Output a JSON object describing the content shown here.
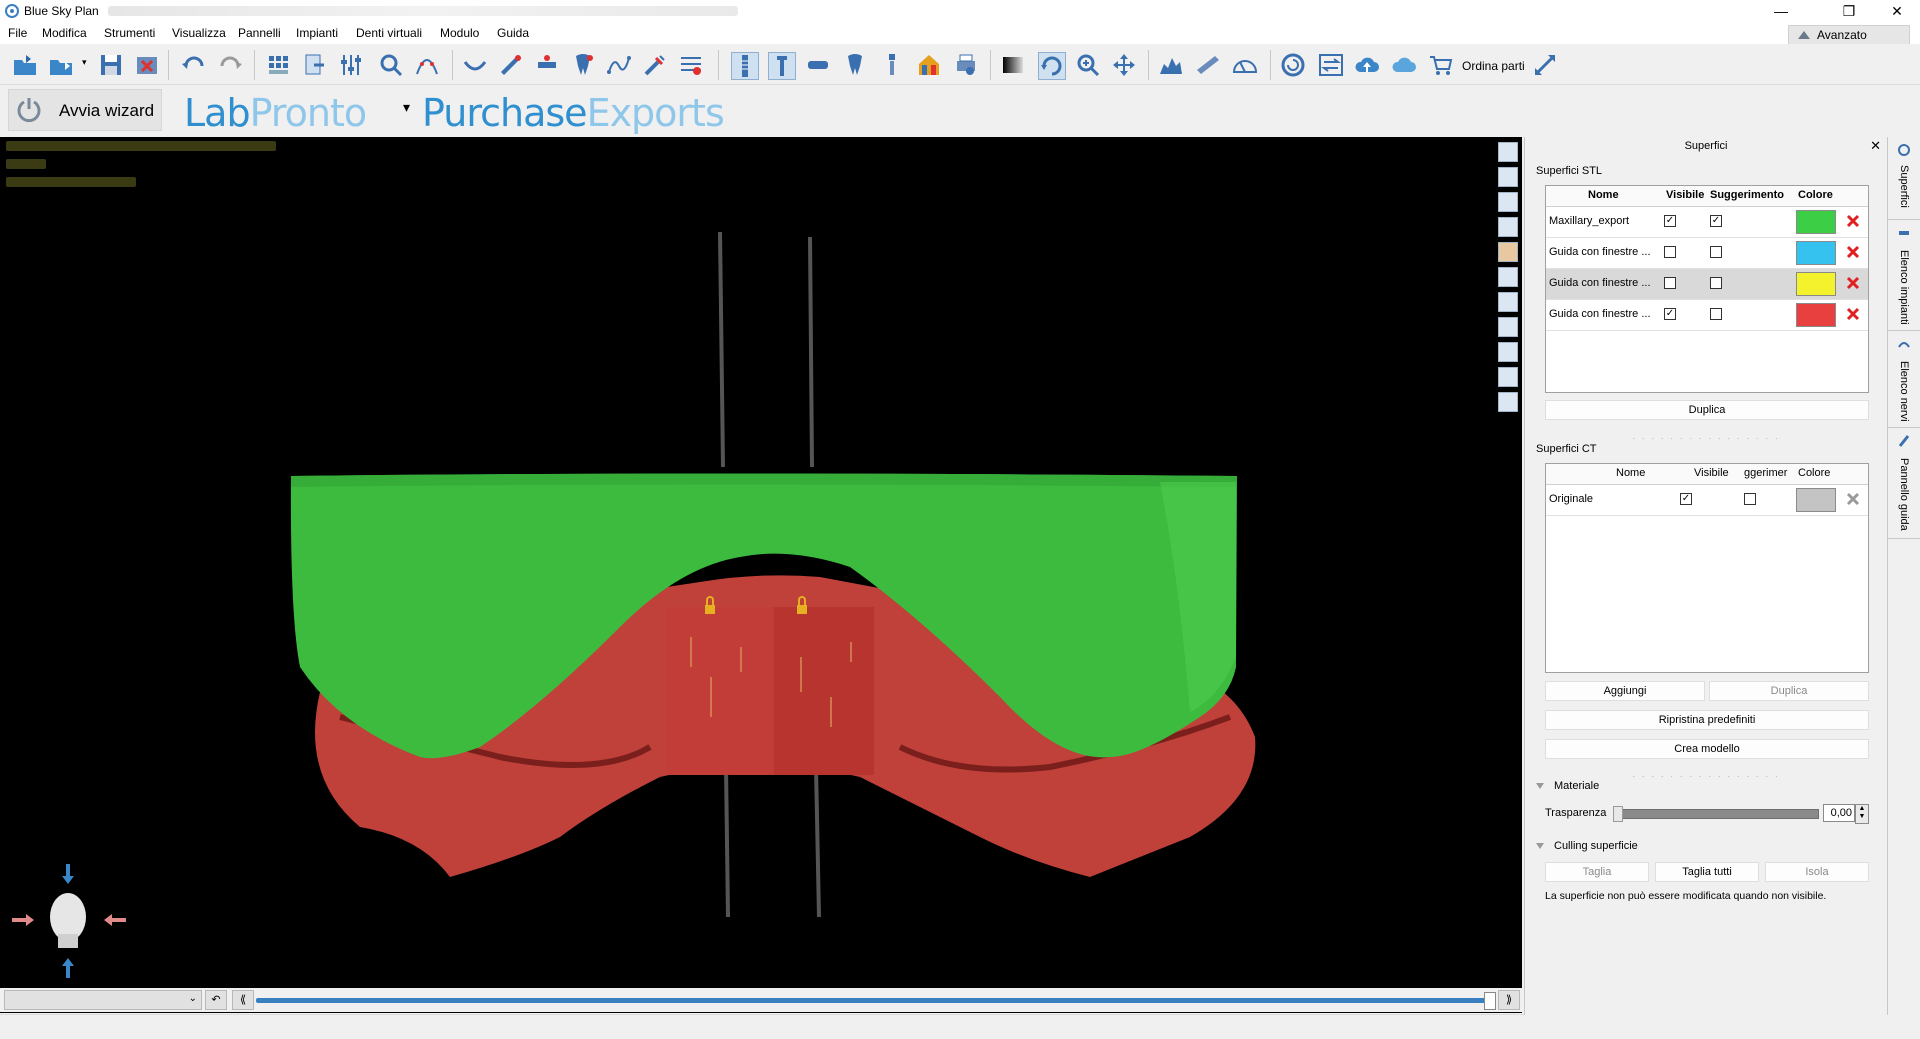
{
  "window": {
    "title": "Blue Sky Plan",
    "minimize": "—",
    "restore": "❐",
    "close": "✕"
  },
  "menu": [
    "File",
    "Modifica",
    "Strumenti",
    "Visualizza",
    "Pannelli",
    "Impianti",
    "Denti virtuali",
    "Modulo",
    "Guida"
  ],
  "advanced_label": "Avanzato",
  "toolbar": {
    "order_parts": "Ordina parti"
  },
  "wizard": {
    "label": "Avvia wizard"
  },
  "brand": {
    "lab_a": "Lab",
    "lab_b": "Pronto",
    "dropdown": "▾",
    "purchase_a": "Purchase",
    "purchase_b": "Exports"
  },
  "timeline": {
    "combo_arrow": "⌄",
    "rewind": "↶",
    "prev": "⟪",
    "next": "⟫"
  },
  "panel": {
    "title": "Superfici",
    "close": "✕",
    "stl": {
      "label": "Superfici STL",
      "headers": {
        "name": "Nome",
        "visible": "Visibile",
        "hint": "Suggerimento",
        "color": "Colore"
      },
      "rows": [
        {
          "name": "Maxillary_export",
          "visible": "✓",
          "hint": "✓",
          "color": "#3ccf45"
        },
        {
          "name": "Guida con finestre ...",
          "visible": "",
          "hint": "",
          "color": "#35c2ee"
        },
        {
          "name": "Guida con finestre ...",
          "visible": "",
          "hint": "",
          "color": "#f4f22c"
        },
        {
          "name": "Guida con finestre ...",
          "visible": "✓",
          "hint": "",
          "color": "#e8403f"
        }
      ],
      "duplicate": "Duplica"
    },
    "ct": {
      "label": "Superfici CT",
      "headers": {
        "name": "Nome",
        "visible": "Visibile",
        "hint": "ggerimer",
        "color": "Colore"
      },
      "rows": [
        {
          "name": "Originale",
          "visible": "✓",
          "hint": "",
          "color": "#c4c4c4"
        }
      ],
      "add": "Aggiungi",
      "duplicate": "Duplica",
      "restore": "Ripristina predefiniti",
      "create_model": "Crea modello"
    },
    "material": {
      "label": "Materiale",
      "transparency_label": "Trasparenza",
      "transparency_value": "0,00",
      "spin_up": "▲",
      "spin_down": "▼"
    },
    "culling": {
      "label": "Culling superficie",
      "cut": "Taglia",
      "cut_all": "Taglia tutti",
      "isolate": "Isola",
      "note": "La superficie non può essere modificata quando non visibile."
    }
  },
  "side_tabs": [
    "Superfici",
    "Elenco impianti",
    "Elenco nervi",
    "Pannello guida"
  ],
  "colors": {
    "guide_green": "#3dbb3f",
    "tissue_red": "#c0403a",
    "accent_blue": "#2f8fcf"
  }
}
